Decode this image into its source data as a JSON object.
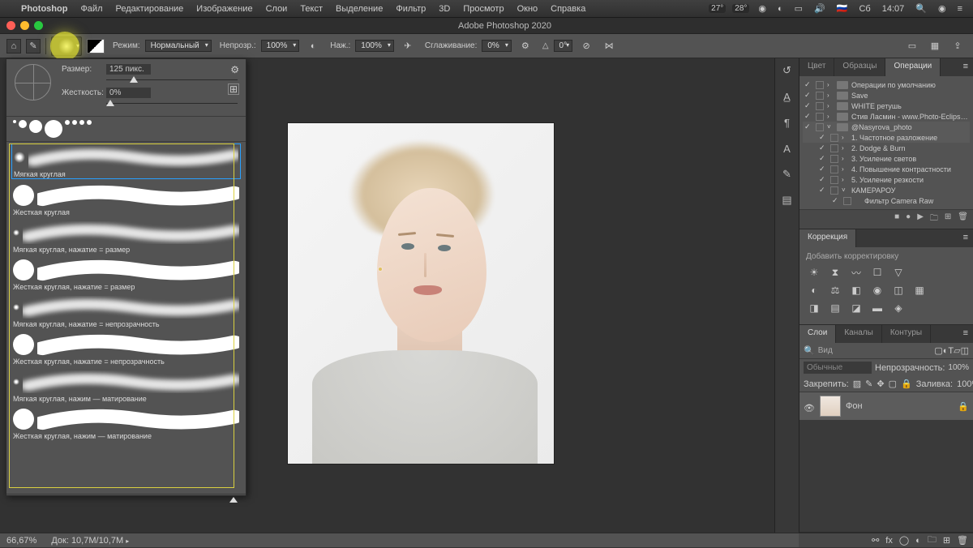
{
  "mac": {
    "app": "Photoshop",
    "menus": [
      "Файл",
      "Редактирование",
      "Изображение",
      "Слои",
      "Текст",
      "Выделение",
      "Фильтр",
      "3D",
      "Просмотр",
      "Окно",
      "Справка"
    ],
    "temp1": "27°",
    "temp2": "28°",
    "battery": "●",
    "flag": "🇷🇺",
    "day": "Сб",
    "time": "14:07"
  },
  "title": "Adobe Photoshop 2020",
  "options": {
    "mode_label": "Режим:",
    "mode_value": "Нормальный",
    "opacity_label": "Непрозр.:",
    "opacity_value": "100%",
    "flow_label": "Наж.:",
    "flow_value": "100%",
    "smooth_label": "Сглаживание:",
    "smooth_value": "0%",
    "angle_label": "△",
    "angle_value": "0°"
  },
  "brush_picker": {
    "size_label": "Размер:",
    "size_value": "125 пикс.",
    "size_thumb_pct": 18,
    "hard_label": "Жесткость:",
    "hard_value": "0%",
    "hard_thumb_pct": 0,
    "size_dots": [
      4,
      10,
      16,
      22,
      6,
      6,
      6,
      6
    ],
    "brushes": [
      {
        "name": "Мягкая круглая",
        "soft": true,
        "selected": true,
        "tipsize": 14
      },
      {
        "name": "Жесткая круглая",
        "soft": false,
        "tipsize": 26
      },
      {
        "name": "Мягкая круглая, нажатие = размер",
        "soft": true,
        "tipsize": 8
      },
      {
        "name": "Жесткая круглая, нажатие = размер",
        "soft": false,
        "tipsize": 26
      },
      {
        "name": "Мягкая круглая, нажатие = непрозрачность",
        "soft": true,
        "tipsize": 8
      },
      {
        "name": "Жесткая круглая, нажатие = непрозрачность",
        "soft": false,
        "tipsize": 26
      },
      {
        "name": "Мягкая круглая, нажим — матирование",
        "soft": true,
        "tipsize": 8
      },
      {
        "name": "Жесткая круглая, нажим — матирование",
        "soft": false,
        "tipsize": 26
      }
    ]
  },
  "right_tabs": {
    "color": "Цвет",
    "swatch": "Образцы",
    "actions": "Операции"
  },
  "actions": [
    {
      "name": "Операции по умолчанию",
      "folder": true,
      "exp": "›"
    },
    {
      "name": "Save",
      "folder": true,
      "exp": "›"
    },
    {
      "name": "WHITE  ретушь",
      "folder": true,
      "exp": "›"
    },
    {
      "name": "Стив Ласмин - www.Photo-Eclipse.ru - Усилива...",
      "folder": true,
      "exp": "›"
    },
    {
      "name": "@Nasyrova_photo",
      "folder": true,
      "exp": "˅",
      "sel": true
    },
    {
      "name": "1. Частотное разложение",
      "indent": 1,
      "exp": "›",
      "sel": true
    },
    {
      "name": "2. Dodge & Burn",
      "indent": 1,
      "exp": "›"
    },
    {
      "name": "3. Усиление светов",
      "indent": 1,
      "exp": "›"
    },
    {
      "name": "4. Повышение контрастности",
      "indent": 1,
      "exp": "›"
    },
    {
      "name": "5. Усиление резкости",
      "indent": 1,
      "exp": "›"
    },
    {
      "name": "КАМЕРАРОУ",
      "indent": 1,
      "exp": "˅"
    },
    {
      "name": "Фильтр Camera Raw",
      "indent": 2
    }
  ],
  "corr": {
    "tab": "Коррекция",
    "hint": "Добавить корректировку"
  },
  "layers": {
    "tab_layers": "Слои",
    "tab_channels": "Каналы",
    "tab_paths": "Контуры",
    "search_kind": "Вид",
    "blend": "Обычные",
    "opacity_label": "Непрозрачность:",
    "opacity": "100%",
    "lock_label": "Закрепить:",
    "fill_label": "Заливка:",
    "fill": "100%",
    "layer_name": "Фон"
  },
  "status": {
    "zoom": "66,67%",
    "doc_label": "Док:",
    "doc": "10,7M/10,7M"
  }
}
